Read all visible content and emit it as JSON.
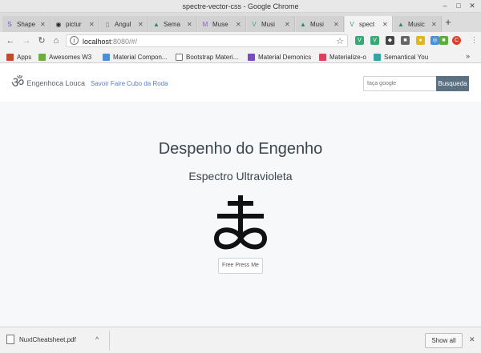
{
  "window": {
    "title": "spectre-vector-css - Google Chrome",
    "controls": {
      "minimize": "–",
      "maximize": "□",
      "close": "✕"
    }
  },
  "tabs": [
    {
      "label": "Shape",
      "icon": "circle-blue-icon",
      "color": "#5b5bd6",
      "glyph": "S"
    },
    {
      "label": "pictur",
      "icon": "github-icon",
      "color": "#222222",
      "glyph": "◉"
    },
    {
      "label": "Angul",
      "icon": "document-icon",
      "color": "#777777",
      "glyph": "▯"
    },
    {
      "label": "Sema",
      "icon": "green-triangle-icon",
      "color": "#2d8a6b",
      "glyph": "▲"
    },
    {
      "label": "Muse",
      "icon": "purple-m-icon",
      "color": "#8c5ac8",
      "glyph": "M"
    },
    {
      "label": "Musi",
      "icon": "vue-icon",
      "color": "#3aa776",
      "glyph": "V"
    },
    {
      "label": "Musi",
      "icon": "green-triangle-icon",
      "color": "#2d8a6b",
      "glyph": "▲"
    },
    {
      "label": "spect",
      "icon": "vue-icon",
      "color": "#3aa776",
      "glyph": "V",
      "active": true
    },
    {
      "label": "Music",
      "icon": "green-triangle-icon",
      "color": "#2d8a6b",
      "glyph": "▲"
    }
  ],
  "toolbar": {
    "url_host": "localhost",
    "url_rest": ":8080/#/",
    "back": "←",
    "forward": "→",
    "reload": "↻",
    "home": "⌂"
  },
  "extensions": [
    {
      "name": "vue-devtools-icon",
      "color": "#3aa776",
      "glyph": "V"
    },
    {
      "name": "vue-icon",
      "color": "#3aa776",
      "glyph": "V"
    },
    {
      "name": "puzzle-icon",
      "color": "#444444",
      "glyph": "◆"
    },
    {
      "name": "square-icon",
      "color": "#666666",
      "glyph": "■"
    },
    {
      "name": "yellow-icon",
      "color": "#e3b61c",
      "glyph": "●"
    },
    {
      "name": "chrome-icon",
      "color": "#4a90d9",
      "glyph": "◎"
    },
    {
      "name": "green-ext-icon",
      "color": "#5cae3b",
      "glyph": "■"
    },
    {
      "name": "profile-icon",
      "color": "#d9412c",
      "glyph": "C"
    },
    {
      "name": "menu-icon",
      "color": "#777777",
      "glyph": "⋮"
    }
  ],
  "bookmarks": [
    {
      "label": "Apps",
      "color": "#c54a2a"
    },
    {
      "label": "Awesomes W3",
      "color": "#6cae3b"
    },
    {
      "label": "Material Compon...",
      "color": "#4a90d9"
    },
    {
      "label": "Bootstrap Materi...",
      "color": "#ffffff"
    },
    {
      "label": "Material Demonics",
      "color": "#7b4ac8"
    },
    {
      "label": "Materialize-o",
      "color": "#e0405a"
    },
    {
      "label": "Semantical You",
      "color": "#35a4a4"
    }
  ],
  "bookmarks_more": "»",
  "site": {
    "brand_glyph": "ॐ",
    "brand_name": "Engenhoca Louca",
    "nav": [
      "Savoir Faire",
      "Cubo da Roda"
    ],
    "search_placeholder": "faça google",
    "search_button": "Busqueda",
    "heading": "Despenho do Engenho",
    "subheading": "Espectro Ultravioleta",
    "symbol": "sulfur-symbol",
    "press_button": "Free Press Me"
  },
  "downloads": {
    "file_name": "NuxtCheatsheet.pdf",
    "show_all": "Show all",
    "chevron": "^",
    "close": "✕"
  }
}
